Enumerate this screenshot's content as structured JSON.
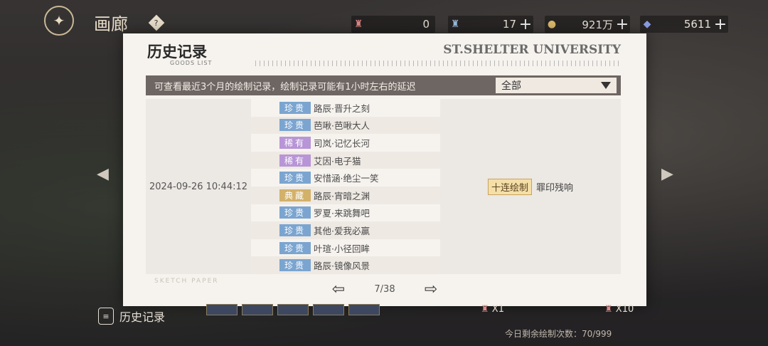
{
  "header": {
    "title": "画廊",
    "help": "?",
    "resources": [
      {
        "icon": "ticket-icon",
        "value": "0"
      },
      {
        "icon": "ticket-blue-icon",
        "value": "17"
      },
      {
        "icon": "coin-icon",
        "value": "921万"
      },
      {
        "icon": "diamond-icon",
        "value": "5611"
      }
    ]
  },
  "dialog": {
    "title": "历史记录",
    "subtitle": "GOODS LIST",
    "brand": "ST.SHELTER UNIVERSITY",
    "info": "可查看最近3个月的绘制记录，绘制记录可能有1小时左右的延迟",
    "filter": "全部",
    "record": {
      "time": "2024-09-26  10:44:12",
      "draw_type": "十连绘制",
      "pool": "罪印残响",
      "items": [
        {
          "rarity": "珍贵",
          "rarity_class": "zg",
          "name": "路辰·晋升之刻"
        },
        {
          "rarity": "珍贵",
          "rarity_class": "zg",
          "name": "芭啾·芭啾大人"
        },
        {
          "rarity": "稀有",
          "rarity_class": "xy",
          "name": "司岚·记忆长河"
        },
        {
          "rarity": "稀有",
          "rarity_class": "xy",
          "name": "艾因·电子猫"
        },
        {
          "rarity": "珍贵",
          "rarity_class": "zg",
          "name": "安惜涵·绝尘一笑"
        },
        {
          "rarity": "典藏",
          "rarity_class": "dc",
          "name": "路辰·宵暗之渊"
        },
        {
          "rarity": "珍贵",
          "rarity_class": "zg",
          "name": "罗夏·来跳舞吧"
        },
        {
          "rarity": "珍贵",
          "rarity_class": "zg",
          "name": "其他·爱我必赢"
        },
        {
          "rarity": "珍贵",
          "rarity_class": "zg",
          "name": "叶瑄·小径回眸"
        },
        {
          "rarity": "珍贵",
          "rarity_class": "zg",
          "name": "路辰·镜像风景"
        }
      ]
    },
    "page": "7/38",
    "watermark": "SKETCH PAPER"
  },
  "footer": {
    "history": "历史记录",
    "x1": "X1",
    "x10": "X10",
    "remain": "今日剩余绘制次数：70/999"
  },
  "colors": {
    "precious": "#7ba5d0",
    "rare": "#b895d6",
    "collection": "#d2b16a"
  }
}
